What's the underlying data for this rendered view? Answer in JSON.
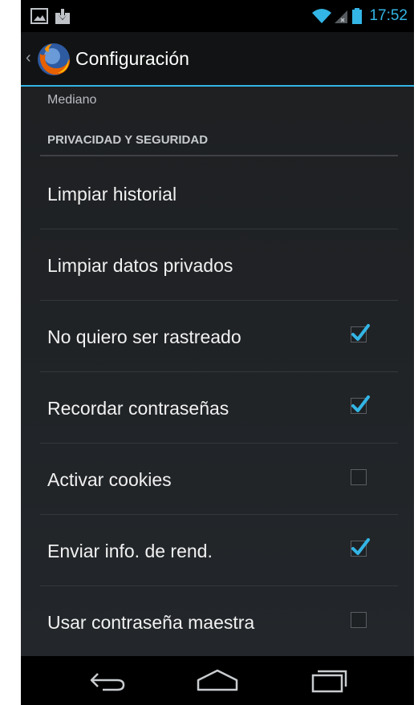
{
  "status_bar": {
    "time": "17:52",
    "icons": [
      "image-notification-icon",
      "download-notification-icon",
      "wifi-icon",
      "signal-icon",
      "battery-icon"
    ]
  },
  "action_bar": {
    "title": "Configuración",
    "icon": "firefox-logo-icon"
  },
  "settings": {
    "previous_value": "Mediano",
    "section_header": "PRIVACIDAD Y SEGURIDAD",
    "items": [
      {
        "label": "Limpiar historial",
        "has_checkbox": false
      },
      {
        "label": "Limpiar datos privados",
        "has_checkbox": false
      },
      {
        "label": "No quiero ser rastreado",
        "has_checkbox": true,
        "checked": true
      },
      {
        "label": "Recordar contraseñas",
        "has_checkbox": true,
        "checked": true
      },
      {
        "label": "Activar cookies",
        "has_checkbox": true,
        "checked": false
      },
      {
        "label": "Enviar info. de rend.",
        "has_checkbox": true,
        "checked": true
      },
      {
        "label": "Usar contraseña maestra",
        "has_checkbox": true,
        "checked": false
      }
    ]
  },
  "nav_bar": {
    "icons": [
      "back-icon",
      "home-icon",
      "recent-apps-icon"
    ]
  },
  "colors": {
    "accent": "#33b5e5",
    "background": "#1e2022",
    "text": "#f1f1f1"
  }
}
